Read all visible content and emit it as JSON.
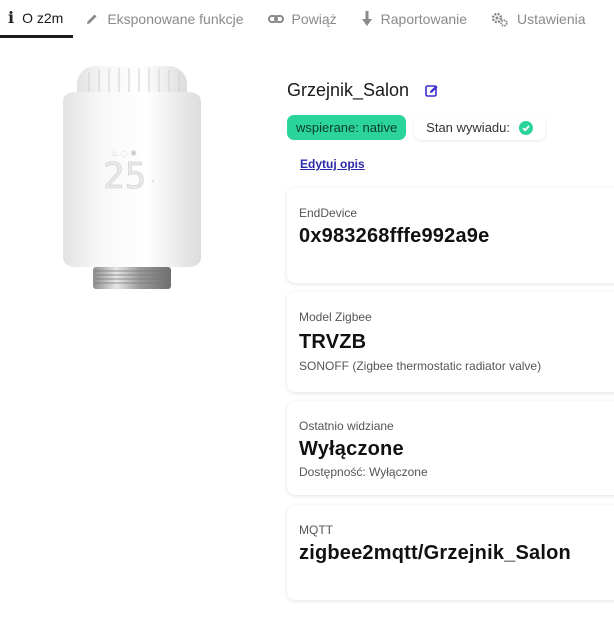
{
  "tabs": [
    {
      "label": "O z2m",
      "icon": "info-icon",
      "active": true
    },
    {
      "label": "Eksponowane funkcje",
      "icon": "pencil-icon",
      "active": false
    },
    {
      "label": "Powiąż",
      "icon": "link-icon",
      "active": false
    },
    {
      "label": "Raportowanie",
      "icon": "download-arrow-icon",
      "active": false
    },
    {
      "label": "Ustawienia",
      "icon": "gears-icon",
      "active": false
    }
  ],
  "device": {
    "name": "Grzejnik_Salon",
    "support_badge": "wspierane: native",
    "interview_label": "Stan wywiadu:",
    "edit_description_link": "Edytuj opis",
    "display_reading": "25"
  },
  "cards": {
    "type": {
      "label": "EndDevice",
      "value": "0x983268fffe992a9e"
    },
    "model": {
      "label": "Model Zigbee",
      "value": "TRVZB",
      "sub": "SONOFF (Zigbee thermostatic radiator valve)"
    },
    "last_seen": {
      "label": "Ostatnio widziane",
      "value": "Wyłączone",
      "sub": "Dostępność: Wyłączone"
    },
    "mqtt": {
      "label": "MQTT",
      "value": "zigbee2mqtt/Grzejnik_Salon"
    }
  },
  "colors": {
    "accent_green": "#2bd49a",
    "link": "#2a2aa8",
    "active_tab_underline": "#1a1a1a"
  }
}
